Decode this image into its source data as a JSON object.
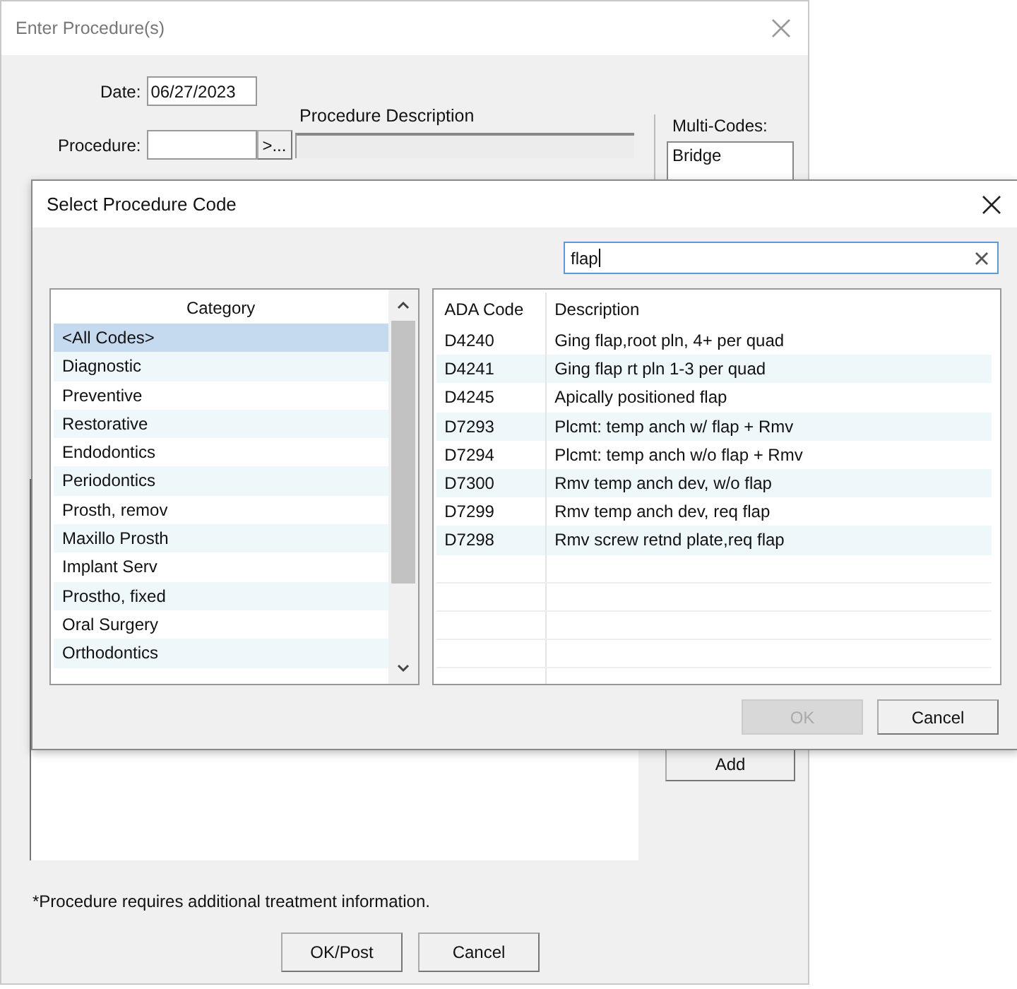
{
  "main_window": {
    "title": "Enter Procedure(s)",
    "date_label": "Date:",
    "date_value": "06/27/2023",
    "procedure_label": "Procedure:",
    "browse_button": ">...",
    "description_label": "Procedure Description",
    "multi_codes_label": "Multi-Codes:",
    "multi_codes": [
      "Bridge"
    ],
    "add_button": "Add",
    "footnote": "*Procedure requires additional treatment information.",
    "buttons": [
      {
        "label": "OK/Post",
        "disabled": false
      },
      {
        "label": "Cancel",
        "disabled": false
      }
    ]
  },
  "dialog": {
    "title": "Select Procedure Code",
    "search": {
      "value": "flap"
    },
    "category_header": "Category",
    "categories": [
      {
        "label": "<All Codes>",
        "selected": true
      },
      {
        "label": "Diagnostic",
        "selected": false
      },
      {
        "label": "Preventive",
        "selected": false
      },
      {
        "label": "Restorative",
        "selected": false
      },
      {
        "label": "Endodontics",
        "selected": false
      },
      {
        "label": "Periodontics",
        "selected": false
      },
      {
        "label": "Prosth, remov",
        "selected": false
      },
      {
        "label": "Maxillo Prosth",
        "selected": false
      },
      {
        "label": "Implant Serv",
        "selected": false
      },
      {
        "label": "Prostho, fixed",
        "selected": false
      },
      {
        "label": "Oral Surgery",
        "selected": false
      },
      {
        "label": "Orthodontics",
        "selected": false
      }
    ],
    "columns": [
      "ADA Code",
      "Description"
    ],
    "rows": [
      [
        "D4240",
        "Ging flap,root pln, 4+ per quad"
      ],
      [
        "D4241",
        "Ging flap rt pln 1-3 per quad"
      ],
      [
        "D4245",
        "Apically positioned flap"
      ],
      [
        "D7293",
        "Plcmt: temp anch w/ flap + Rmv"
      ],
      [
        "D7294",
        "Plcmt: temp anch w/o flap + Rmv"
      ],
      [
        "D7300",
        "Rmv temp anch dev, w/o flap"
      ],
      [
        "D7299",
        "Rmv temp anch dev, req flap"
      ],
      [
        "D7298",
        "Rmv screw retnd plate,req flap"
      ]
    ],
    "buttons": [
      {
        "label": "OK",
        "disabled": true
      },
      {
        "label": "Cancel",
        "disabled": false
      }
    ]
  }
}
